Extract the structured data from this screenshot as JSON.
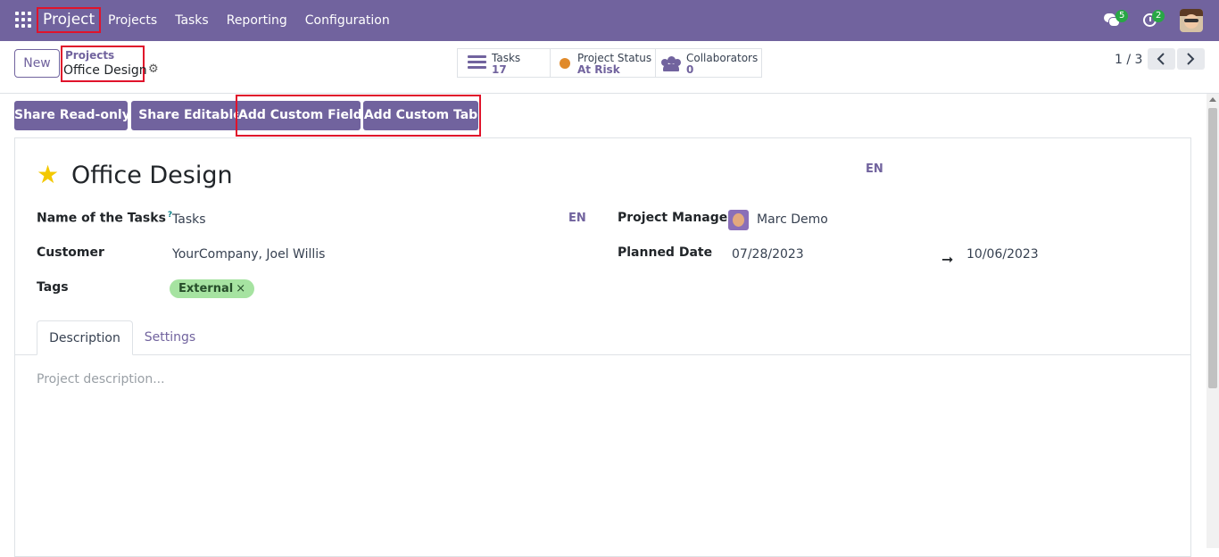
{
  "navbar": {
    "brand": "Project",
    "menu": [
      "Projects",
      "Tasks",
      "Reporting",
      "Configuration"
    ],
    "messages_count": "5",
    "activities_count": "2"
  },
  "control": {
    "new_label": "New",
    "breadcrumb_parent": "Projects",
    "breadcrumb_current": "Office Design",
    "smart_buttons": {
      "tasks_label": "Tasks",
      "tasks_value": "17",
      "status_label": "Project Status",
      "status_value": "At Risk",
      "collab_label": "Collaborators",
      "collab_value": "0"
    },
    "pager": "1 / 3"
  },
  "actions": {
    "share_readonly": "Share Read-only",
    "share_editable": "Share Editable",
    "add_custom_field": "Add Custom Field",
    "add_custom_tab": "Add Custom Tab"
  },
  "form": {
    "title": "Office Design",
    "lang": "EN",
    "name_tasks_label": "Name of the Tasks",
    "name_tasks_help": "?",
    "name_tasks_value": "Tasks",
    "customer_label": "Customer",
    "customer_value": "YourCompany, Joel Willis",
    "tags_label": "Tags",
    "tag_value": "External",
    "tag_remove": "×",
    "manager_label": "Project Manager",
    "manager_value": "Marc Demo",
    "planned_label": "Planned Date",
    "planned_start": "07/28/2023",
    "planned_arrow": "➞",
    "planned_end": "10/06/2023",
    "tabs": [
      "Description",
      "Settings"
    ],
    "description_placeholder": "Project description..."
  },
  "colors": {
    "primary": "#71639e",
    "highlight": "#e0132b",
    "tag_bg": "#a6e3a1",
    "star": "#f3c800",
    "badge": "#28a745"
  }
}
